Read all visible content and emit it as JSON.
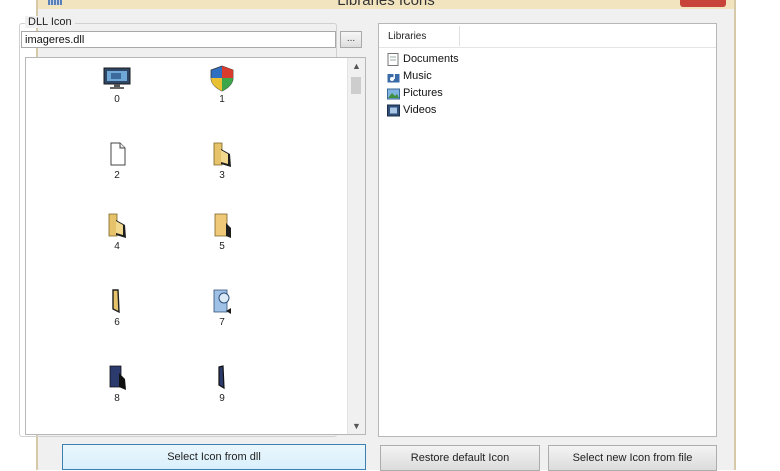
{
  "window": {
    "title": "Libraries Icons"
  },
  "dll_group": {
    "label": "DLL Icon",
    "file_value": "imageres.dll",
    "browse_label": "..."
  },
  "icons": [
    {
      "index": "0",
      "icon": "monitor-icon"
    },
    {
      "index": "1",
      "icon": "shield-icon"
    },
    {
      "index": "2",
      "icon": "blank-document-icon"
    },
    {
      "index": "3",
      "icon": "open-folder-icon"
    },
    {
      "index": "4",
      "icon": "open-folder-icon"
    },
    {
      "index": "5",
      "icon": "folder-icon"
    },
    {
      "index": "6",
      "icon": "half-folder-icon"
    },
    {
      "index": "7",
      "icon": "search-folder-icon"
    },
    {
      "index": "8",
      "icon": "dark-folder-icon"
    },
    {
      "index": "9",
      "icon": "dark-half-folder-icon"
    }
  ],
  "buttons": {
    "select_from_dll": "Select Icon from dll",
    "restore_default": "Restore default Icon",
    "select_from_file": "Select new Icon from file"
  },
  "libraries": {
    "header": "Libraries",
    "items": [
      {
        "label": "Documents",
        "icon": "documents-icon"
      },
      {
        "label": "Music",
        "icon": "music-icon"
      },
      {
        "label": "Pictures",
        "icon": "pictures-icon"
      },
      {
        "label": "Videos",
        "icon": "videos-icon"
      }
    ]
  },
  "colors": {
    "window_bg": "#f0f0f0",
    "titlebar": "#f1e4bf",
    "close_button": "#c8443a",
    "folder": "#e6c36a",
    "dark_folder": "#2b3b6e"
  }
}
